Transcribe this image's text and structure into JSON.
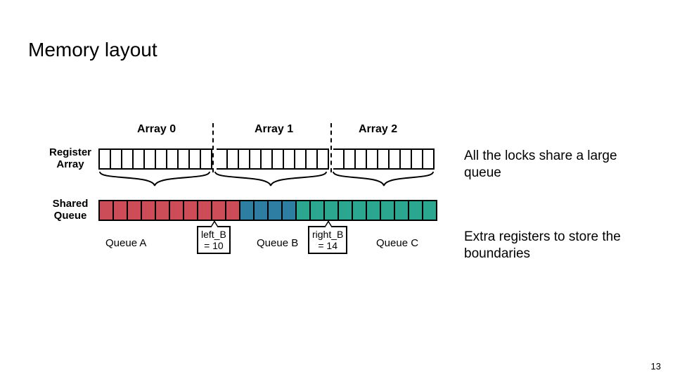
{
  "title": "Memory layout",
  "page_number": "13",
  "notes": {
    "shared_queue": "All the locks share a large queue",
    "boundaries": "Extra registers to store the boundaries"
  },
  "register_array": {
    "caption_line1": "Register",
    "caption_line2": "Array",
    "groups": [
      {
        "label": "Array 0",
        "cells": 10
      },
      {
        "label": "Array 1",
        "cells": 10
      },
      {
        "label": "Array 2",
        "cells": 9
      }
    ]
  },
  "shared_queue": {
    "caption_line1": "Shared",
    "caption_line2": "Queue",
    "total_cells": 24,
    "segments": [
      {
        "name": "Queue A",
        "color": "#cc4c58",
        "start": 0,
        "end": 10
      },
      {
        "name": "Queue B",
        "color": "#2e7ea3",
        "start": 10,
        "end": 14
      },
      {
        "name": "Queue C",
        "color": "#2aa78e",
        "start": 14,
        "end": 24
      }
    ],
    "boundary_registers": {
      "left_B": {
        "label_line1": "left_B",
        "label_line2": "= 10",
        "value": 10
      },
      "right_B": {
        "label_line1": "right_B",
        "label_line2": "= 14",
        "value": 14
      }
    },
    "bottom_labels": {
      "queue_a": "Queue A",
      "queue_b": "Queue B",
      "queue_c": "Queue C"
    }
  },
  "chart_data": {
    "type": "table",
    "description": "Memory layout: a register array partitioned into three groups and a shared queue partitioned into three color segments with boundary index registers.",
    "register_array_groups": [
      {
        "label": "Array 0",
        "size": 10
      },
      {
        "label": "Array 1",
        "size": 10
      },
      {
        "label": "Array 2",
        "size": 9
      }
    ],
    "shared_queue": {
      "length": 24,
      "segments": [
        {
          "name": "Queue A",
          "range": [
            0,
            10
          ],
          "color": "#cc4c58"
        },
        {
          "name": "Queue B",
          "range": [
            10,
            14
          ],
          "color": "#2e7ea3"
        },
        {
          "name": "Queue C",
          "range": [
            14,
            24
          ],
          "color": "#2aa78e"
        }
      ],
      "left_B": 10,
      "right_B": 14
    }
  }
}
